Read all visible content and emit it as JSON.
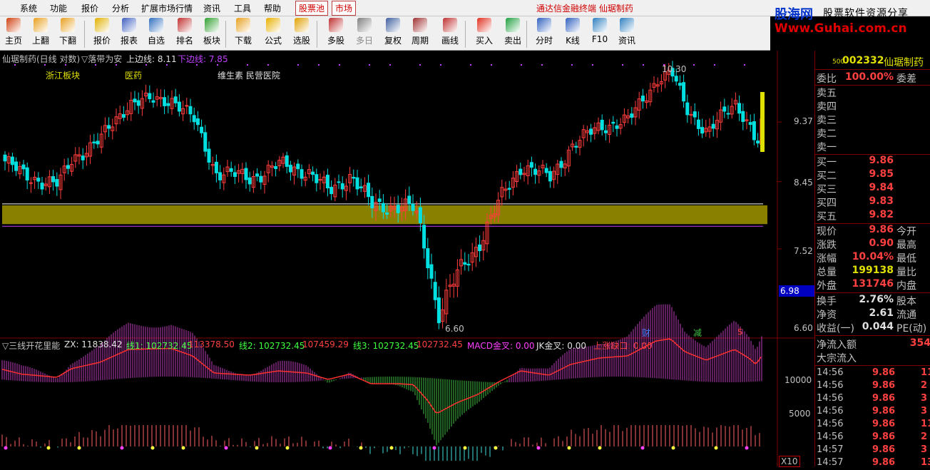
{
  "menu": {
    "items": [
      "系统",
      "功能",
      "报价",
      "分析",
      "扩展市场行情",
      "资讯",
      "工具",
      "帮助"
    ],
    "tabs": [
      "股票池",
      "市场"
    ],
    "marquee": "通达信金融终端  仙琚制药"
  },
  "logo": {
    "cn": "股海网",
    "slogan": "股票软件资源分享",
    "url": "Www.Guhai.com.cn"
  },
  "toolbar": {
    "buttons": [
      {
        "label": "主页",
        "icon": "home-icon",
        "color": "#d04010"
      },
      {
        "label": "上翻",
        "icon": "arrow-up-icon",
        "color": "#e8a020"
      },
      {
        "label": "下翻",
        "icon": "arrow-down-icon",
        "color": "#e8a020"
      },
      {
        "label": "报价",
        "icon": "yen-icon",
        "color": "#e0b000"
      },
      {
        "label": "报表",
        "icon": "report-icon",
        "color": "#4060c0"
      },
      {
        "label": "自选",
        "icon": "f6-icon",
        "color": "#3070c0"
      },
      {
        "label": "排名",
        "icon": "rank-icon",
        "color": "#c03030"
      },
      {
        "label": "板块",
        "icon": "sector-icon",
        "color": "#30a030"
      },
      {
        "label": "下载",
        "icon": "download-icon",
        "color": "#e8a020"
      },
      {
        "label": "公式",
        "icon": "formula-icon",
        "color": "#e8b000"
      },
      {
        "label": "选股",
        "icon": "pick-stock-icon",
        "color": "#e0a000"
      },
      {
        "label": "多股",
        "icon": "multi-stock-icon",
        "color": "#c03030"
      },
      {
        "label": "多日",
        "icon": "multi-day-icon",
        "color": "#808080"
      },
      {
        "label": "复权",
        "icon": "restore-rights-icon",
        "color": "#4060a0"
      },
      {
        "label": "周期",
        "icon": "f8-icon",
        "color": "#a03030"
      },
      {
        "label": "画线",
        "icon": "draw-line-icon",
        "color": "#c03030"
      },
      {
        "label": "买入",
        "icon": "buy-icon",
        "color": "#e03020"
      },
      {
        "label": "卖出",
        "icon": "sell-icon",
        "color": "#20a040"
      },
      {
        "label": "分时",
        "icon": "intraday-icon",
        "color": "#3060c0"
      },
      {
        "label": "K线",
        "icon": "kline-icon",
        "color": "#3060c0"
      },
      {
        "label": "F10",
        "icon": "f10-icon",
        "color": "#3080c0"
      },
      {
        "label": "资讯",
        "icon": "news-icon",
        "color": "#3080c0"
      }
    ]
  },
  "main_chart": {
    "title": "仙琚制药(日线 对数)",
    "indicator": "▽落带为安",
    "upper_label": "上边线: 8.11",
    "lower_label": "下边线: 7.85",
    "tags": [
      "浙江板块",
      "医药",
      "维生素 民营医院"
    ],
    "high_mark": "10.30",
    "low_mark": "6.60",
    "current_price_box": "6.98",
    "event_marks": [
      "财",
      "减",
      "$"
    ]
  },
  "sub_chart": {
    "title": "▽三线开花里能",
    "zx": "ZX: 11838.42",
    "line1": "线1: 102732.45",
    "line1b": "113378.50",
    "line2": "线2: 102732.45",
    "line2b": "107459.29",
    "line3": "线3: 102732.45",
    "line3b": "102732.45",
    "macd": "MACD金叉: 0.00",
    "jk": "JK金叉: 0.00",
    "gap": "上涨缺口: 0.00",
    "x10": "X10"
  },
  "chart_data": {
    "type": "candlestick",
    "price_axis_ticks": [
      "9.37",
      "8.45",
      "7.52",
      "6.60"
    ],
    "sub_axis_ticks": [
      "10000",
      "5000"
    ],
    "band": {
      "upper": 8.11,
      "lower": 7.85
    },
    "high": 10.3,
    "low": 6.6
  },
  "quote": {
    "code": "002332",
    "name": "仙琚制药",
    "code_sup": "500",
    "weibi": {
      "k": "委比",
      "v": "100.00%",
      "k2": "委差"
    },
    "asks": [
      {
        "k": "卖五",
        "v": ""
      },
      {
        "k": "卖四",
        "v": ""
      },
      {
        "k": "卖三",
        "v": ""
      },
      {
        "k": "卖二",
        "v": ""
      },
      {
        "k": "卖一",
        "v": ""
      }
    ],
    "bids": [
      {
        "k": "买一",
        "v": "9.86"
      },
      {
        "k": "买二",
        "v": "9.85"
      },
      {
        "k": "买三",
        "v": "9.84"
      },
      {
        "k": "买四",
        "v": "9.83"
      },
      {
        "k": "买五",
        "v": "9.82"
      }
    ],
    "stats1": [
      {
        "k": "现价",
        "v": "9.86",
        "k2": "今开",
        "color": "#ff4040"
      },
      {
        "k": "涨跌",
        "v": "0.90",
        "k2": "最高",
        "color": "#ff4040"
      },
      {
        "k": "涨幅",
        "v": "10.04%",
        "k2": "最低",
        "color": "#ff4040"
      },
      {
        "k": "总量",
        "v": "199138",
        "k2": "量比",
        "color": "#e0e000"
      },
      {
        "k": "外盘",
        "v": "131746",
        "k2": "内盘",
        "color": "#ff4040"
      }
    ],
    "stats2": [
      {
        "k": "换手",
        "v": "2.76%",
        "k2": "股本",
        "color": "#e0e0e0"
      },
      {
        "k": "净资",
        "v": "2.61",
        "k2": "流通",
        "color": "#e0e0e0"
      },
      {
        "k": "收益(一)",
        "v": "0.044",
        "k2": "PE(动)",
        "color": "#e0e0e0"
      }
    ],
    "netflow": {
      "k": "净流入额",
      "v": "354"
    },
    "bigflow": {
      "k": "大宗流入"
    },
    "ticks": [
      {
        "t": "14:56",
        "p": "9.86",
        "n": "11"
      },
      {
        "t": "14:56",
        "p": "9.86",
        "n": "2"
      },
      {
        "t": "14:56",
        "p": "9.86",
        "n": "3"
      },
      {
        "t": "14:56",
        "p": "9.86",
        "n": "3"
      },
      {
        "t": "14:56",
        "p": "9.86",
        "n": "11"
      },
      {
        "t": "14:56",
        "p": "9.86",
        "n": "2"
      },
      {
        "t": "14:57",
        "p": "9.86",
        "n": "3"
      },
      {
        "t": "14:57",
        "p": "9.86",
        "n": "13"
      }
    ]
  },
  "colors": {
    "up": "#ff3c3c",
    "down": "#00e0e0",
    "band": "#8a8000",
    "macd_pos": "#c040c0",
    "macd_neg": "#40c040",
    "accent": "#e0e000"
  }
}
